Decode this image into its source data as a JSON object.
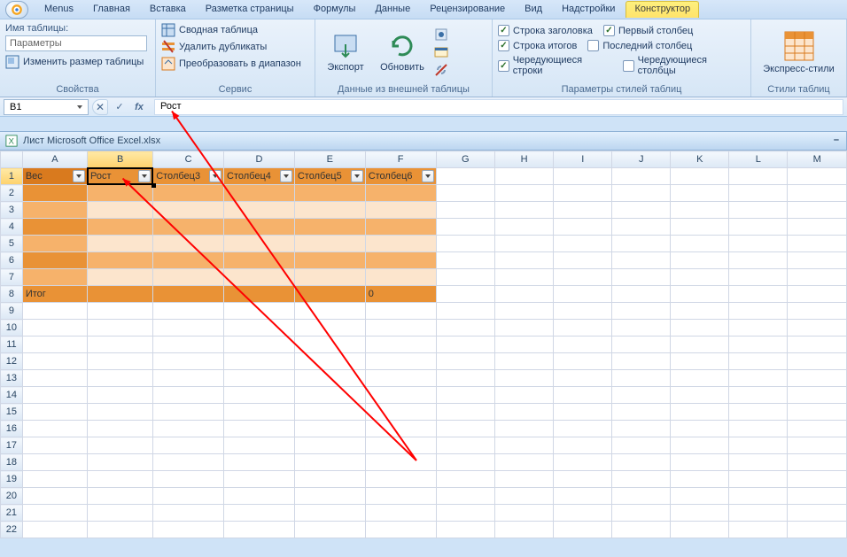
{
  "tabs": {
    "menus": "Menus",
    "home": "Главная",
    "insert": "Вставка",
    "layout": "Разметка страницы",
    "formulas": "Формулы",
    "data": "Данные",
    "review": "Рецензирование",
    "view": "Вид",
    "addins": "Надстройки",
    "design": "Конструктор"
  },
  "group1": {
    "label": "Свойства",
    "name_label": "Имя таблицы:",
    "name_value": "Параметры",
    "resize": "Изменить размер таблицы"
  },
  "group2": {
    "label": "Сервис",
    "pivot": "Сводная таблица",
    "dedup": "Удалить дубликаты",
    "convert": "Преобразовать в диапазон"
  },
  "group3": {
    "label": "Данные из внешней таблицы",
    "export": "Экспорт",
    "refresh": "Обновить"
  },
  "group4": {
    "label": "Параметры стилей таблиц",
    "header_row": "Строка заголовка",
    "total_row": "Строка итогов",
    "banded_rows": "Чередующиеся строки",
    "first_col": "Первый столбец",
    "last_col": "Последний столбец",
    "banded_cols": "Чередующиеся столбцы"
  },
  "group5": {
    "label": "Стили таблиц",
    "express": "Экспресс-стили"
  },
  "namebox": "B1",
  "formula": "Рост",
  "doc_title": "Лист Microsoft Office Excel.xlsx",
  "cols": [
    "A",
    "B",
    "C",
    "D",
    "E",
    "F",
    "G",
    "H",
    "I",
    "J",
    "K",
    "L",
    "M"
  ],
  "rows": [
    "1",
    "2",
    "3",
    "4",
    "5",
    "6",
    "7",
    "8",
    "9",
    "10",
    "11",
    "12",
    "13",
    "14",
    "15",
    "16",
    "17",
    "18",
    "19",
    "20",
    "21",
    "22"
  ],
  "headers": {
    "c1": "Вес",
    "c2": "Рост",
    "c3": "Столбец3",
    "c4": "Столбец4",
    "c5": "Столбец5",
    "c6": "Столбец6"
  },
  "total_label": "Итог",
  "total_value": "0"
}
